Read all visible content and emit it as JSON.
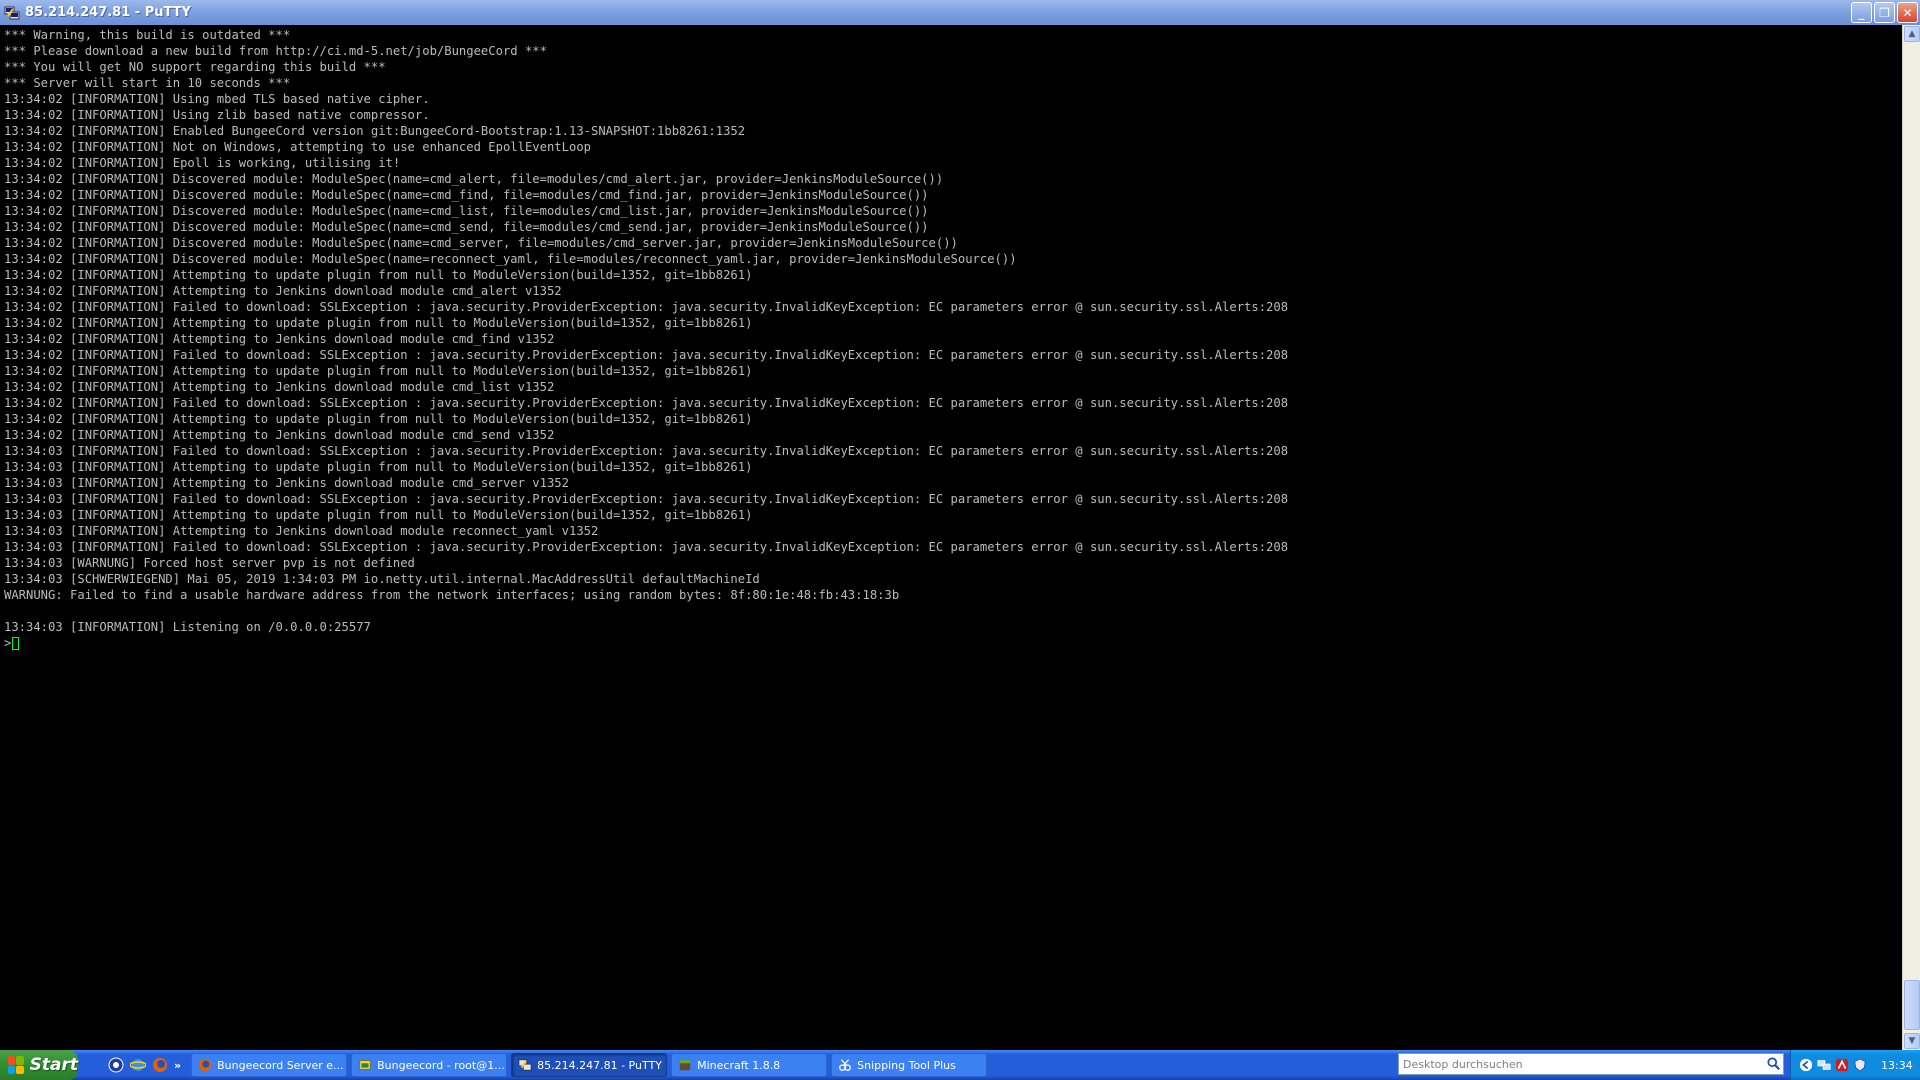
{
  "window": {
    "title": "85.214.247.81 - PuTTY",
    "minimize": "_",
    "restore": "❐",
    "close": "✕"
  },
  "terminal": {
    "lines": [
      "*** Warning, this build is outdated ***",
      "*** Please download a new build from http://ci.md-5.net/job/BungeeCord ***",
      "*** You will get NO support regarding this build ***",
      "*** Server will start in 10 seconds ***",
      "13:34:02 [INFORMATION] Using mbed TLS based native cipher.",
      "13:34:02 [INFORMATION] Using zlib based native compressor.",
      "13:34:02 [INFORMATION] Enabled BungeeCord version git:BungeeCord-Bootstrap:1.13-SNAPSHOT:1bb8261:1352",
      "13:34:02 [INFORMATION] Not on Windows, attempting to use enhanced EpollEventLoop",
      "13:34:02 [INFORMATION] Epoll is working, utilising it!",
      "13:34:02 [INFORMATION] Discovered module: ModuleSpec(name=cmd_alert, file=modules/cmd_alert.jar, provider=JenkinsModuleSource())",
      "13:34:02 [INFORMATION] Discovered module: ModuleSpec(name=cmd_find, file=modules/cmd_find.jar, provider=JenkinsModuleSource())",
      "13:34:02 [INFORMATION] Discovered module: ModuleSpec(name=cmd_list, file=modules/cmd_list.jar, provider=JenkinsModuleSource())",
      "13:34:02 [INFORMATION] Discovered module: ModuleSpec(name=cmd_send, file=modules/cmd_send.jar, provider=JenkinsModuleSource())",
      "13:34:02 [INFORMATION] Discovered module: ModuleSpec(name=cmd_server, file=modules/cmd_server.jar, provider=JenkinsModuleSource())",
      "13:34:02 [INFORMATION] Discovered module: ModuleSpec(name=reconnect_yaml, file=modules/reconnect_yaml.jar, provider=JenkinsModuleSource())",
      "13:34:02 [INFORMATION] Attempting to update plugin from null to ModuleVersion(build=1352, git=1bb8261)",
      "13:34:02 [INFORMATION] Attempting to Jenkins download module cmd_alert v1352",
      "13:34:02 [INFORMATION] Failed to download: SSLException : java.security.ProviderException: java.security.InvalidKeyException: EC parameters error @ sun.security.ssl.Alerts:208",
      "13:34:02 [INFORMATION] Attempting to update plugin from null to ModuleVersion(build=1352, git=1bb8261)",
      "13:34:02 [INFORMATION] Attempting to Jenkins download module cmd_find v1352",
      "13:34:02 [INFORMATION] Failed to download: SSLException : java.security.ProviderException: java.security.InvalidKeyException: EC parameters error @ sun.security.ssl.Alerts:208",
      "13:34:02 [INFORMATION] Attempting to update plugin from null to ModuleVersion(build=1352, git=1bb8261)",
      "13:34:02 [INFORMATION] Attempting to Jenkins download module cmd_list v1352",
      "13:34:02 [INFORMATION] Failed to download: SSLException : java.security.ProviderException: java.security.InvalidKeyException: EC parameters error @ sun.security.ssl.Alerts:208",
      "13:34:02 [INFORMATION] Attempting to update plugin from null to ModuleVersion(build=1352, git=1bb8261)",
      "13:34:02 [INFORMATION] Attempting to Jenkins download module cmd_send v1352",
      "13:34:03 [INFORMATION] Failed to download: SSLException : java.security.ProviderException: java.security.InvalidKeyException: EC parameters error @ sun.security.ssl.Alerts:208",
      "13:34:03 [INFORMATION] Attempting to update plugin from null to ModuleVersion(build=1352, git=1bb8261)",
      "13:34:03 [INFORMATION] Attempting to Jenkins download module cmd_server v1352",
      "13:34:03 [INFORMATION] Failed to download: SSLException : java.security.ProviderException: java.security.InvalidKeyException: EC parameters error @ sun.security.ssl.Alerts:208",
      "13:34:03 [INFORMATION] Attempting to update plugin from null to ModuleVersion(build=1352, git=1bb8261)",
      "13:34:03 [INFORMATION] Attempting to Jenkins download module reconnect_yaml v1352",
      "13:34:03 [INFORMATION] Failed to download: SSLException : java.security.ProviderException: java.security.InvalidKeyException: EC parameters error @ sun.security.ssl.Alerts:208",
      "13:34:03 [WARNUNG] Forced host server pvp is not defined",
      "13:34:03 [SCHWERWIEGEND] Mai 05, 2019 1:34:03 PM io.netty.util.internal.MacAddressUtil defaultMachineId",
      "WARNUNG: Failed to find a usable hardware address from the network interfaces; using random bytes: 8f:80:1e:48:fb:43:18:3b",
      "",
      "13:34:03 [INFORMATION] Listening on /0.0.0.0:25577"
    ],
    "prompt": ">"
  },
  "taskbar": {
    "start_label": "Start",
    "quick_launch_more": "»",
    "items": [
      {
        "label": "Bungeecord Server e...",
        "icon": "firefox-icon"
      },
      {
        "label": "Bungeecord - root@1...",
        "icon": "file-manager-icon"
      },
      {
        "label": "85.214.247.81 - PuTTY",
        "icon": "putty-icon"
      },
      {
        "label": "Minecraft 1.8.8",
        "icon": "minecraft-icon"
      },
      {
        "label": "Snipping Tool Plus",
        "icon": "snipping-tool-icon"
      }
    ],
    "search_placeholder": "Desktop durchsuchen",
    "clock": "13:34"
  },
  "colors": {
    "terminal_bg": "#000000",
    "terminal_fg": "#bbbbbb",
    "cursor": "#00ff00",
    "taskbar_blue": "#245edb",
    "start_green": "#2f8f2f"
  }
}
